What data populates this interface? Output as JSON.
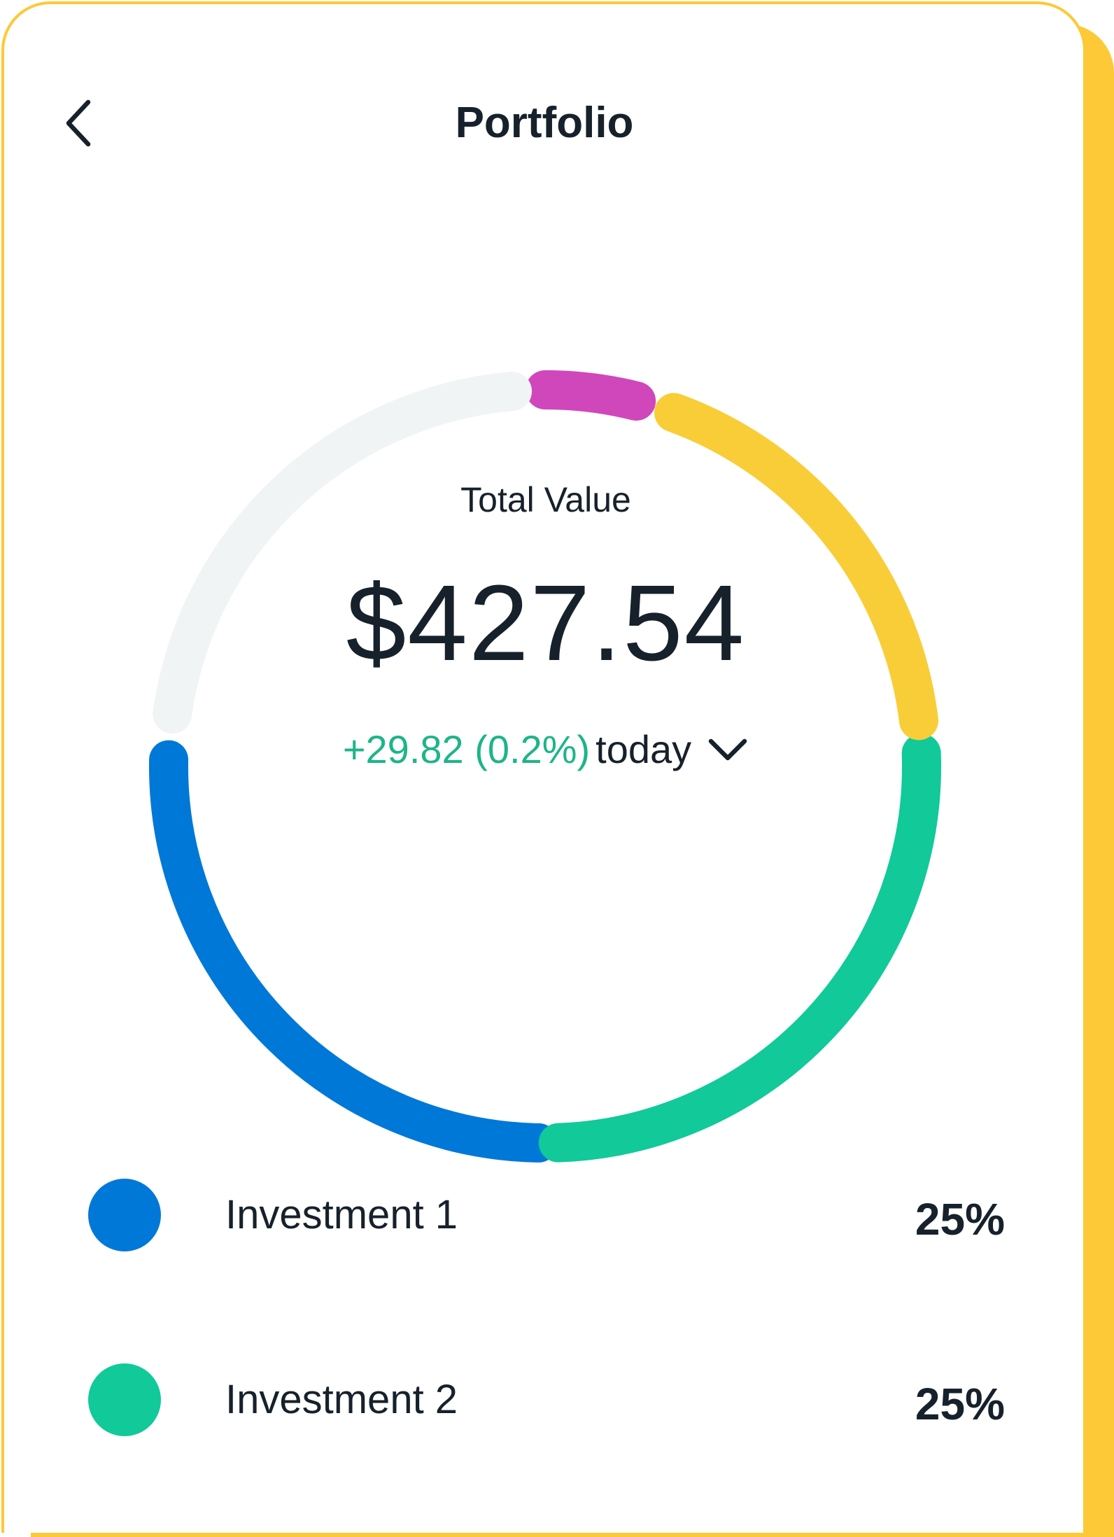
{
  "header": {
    "title": "Portfolio",
    "back_icon": "chevron-left-icon"
  },
  "summary": {
    "label": "Total Value",
    "total": "$427.54",
    "change": "+29.82 (0.2%)",
    "period": "today",
    "dropdown_icon": "chevron-down-icon"
  },
  "colors": {
    "accent_frame": "#FDC937",
    "text": "#17212b",
    "gain": "#1DB588",
    "investment_1": "#0078D8",
    "investment_2": "#11C999",
    "magenta_segment": "#D047BC",
    "yellow_segment": "#F9CD37",
    "unallocated_segment": "#F1F4F5"
  },
  "chart_data": {
    "type": "pie",
    "variant": "donut-ring",
    "segments": [
      {
        "label": "Investment 1",
        "percent": 25,
        "color": "#0078D8"
      },
      {
        "label": "Investment 2",
        "percent": 25,
        "color": "#11C999"
      },
      {
        "label": "",
        "color": "#F9CD37"
      },
      {
        "label": "",
        "color": "#D047BC"
      },
      {
        "label": "",
        "color": "#F1F4F5"
      }
    ]
  },
  "legend": [
    {
      "label": "Investment 1",
      "percent": "25%",
      "color": "#0078D8"
    },
    {
      "label": "Investment 2",
      "percent": "25%",
      "color": "#11C999"
    }
  ]
}
